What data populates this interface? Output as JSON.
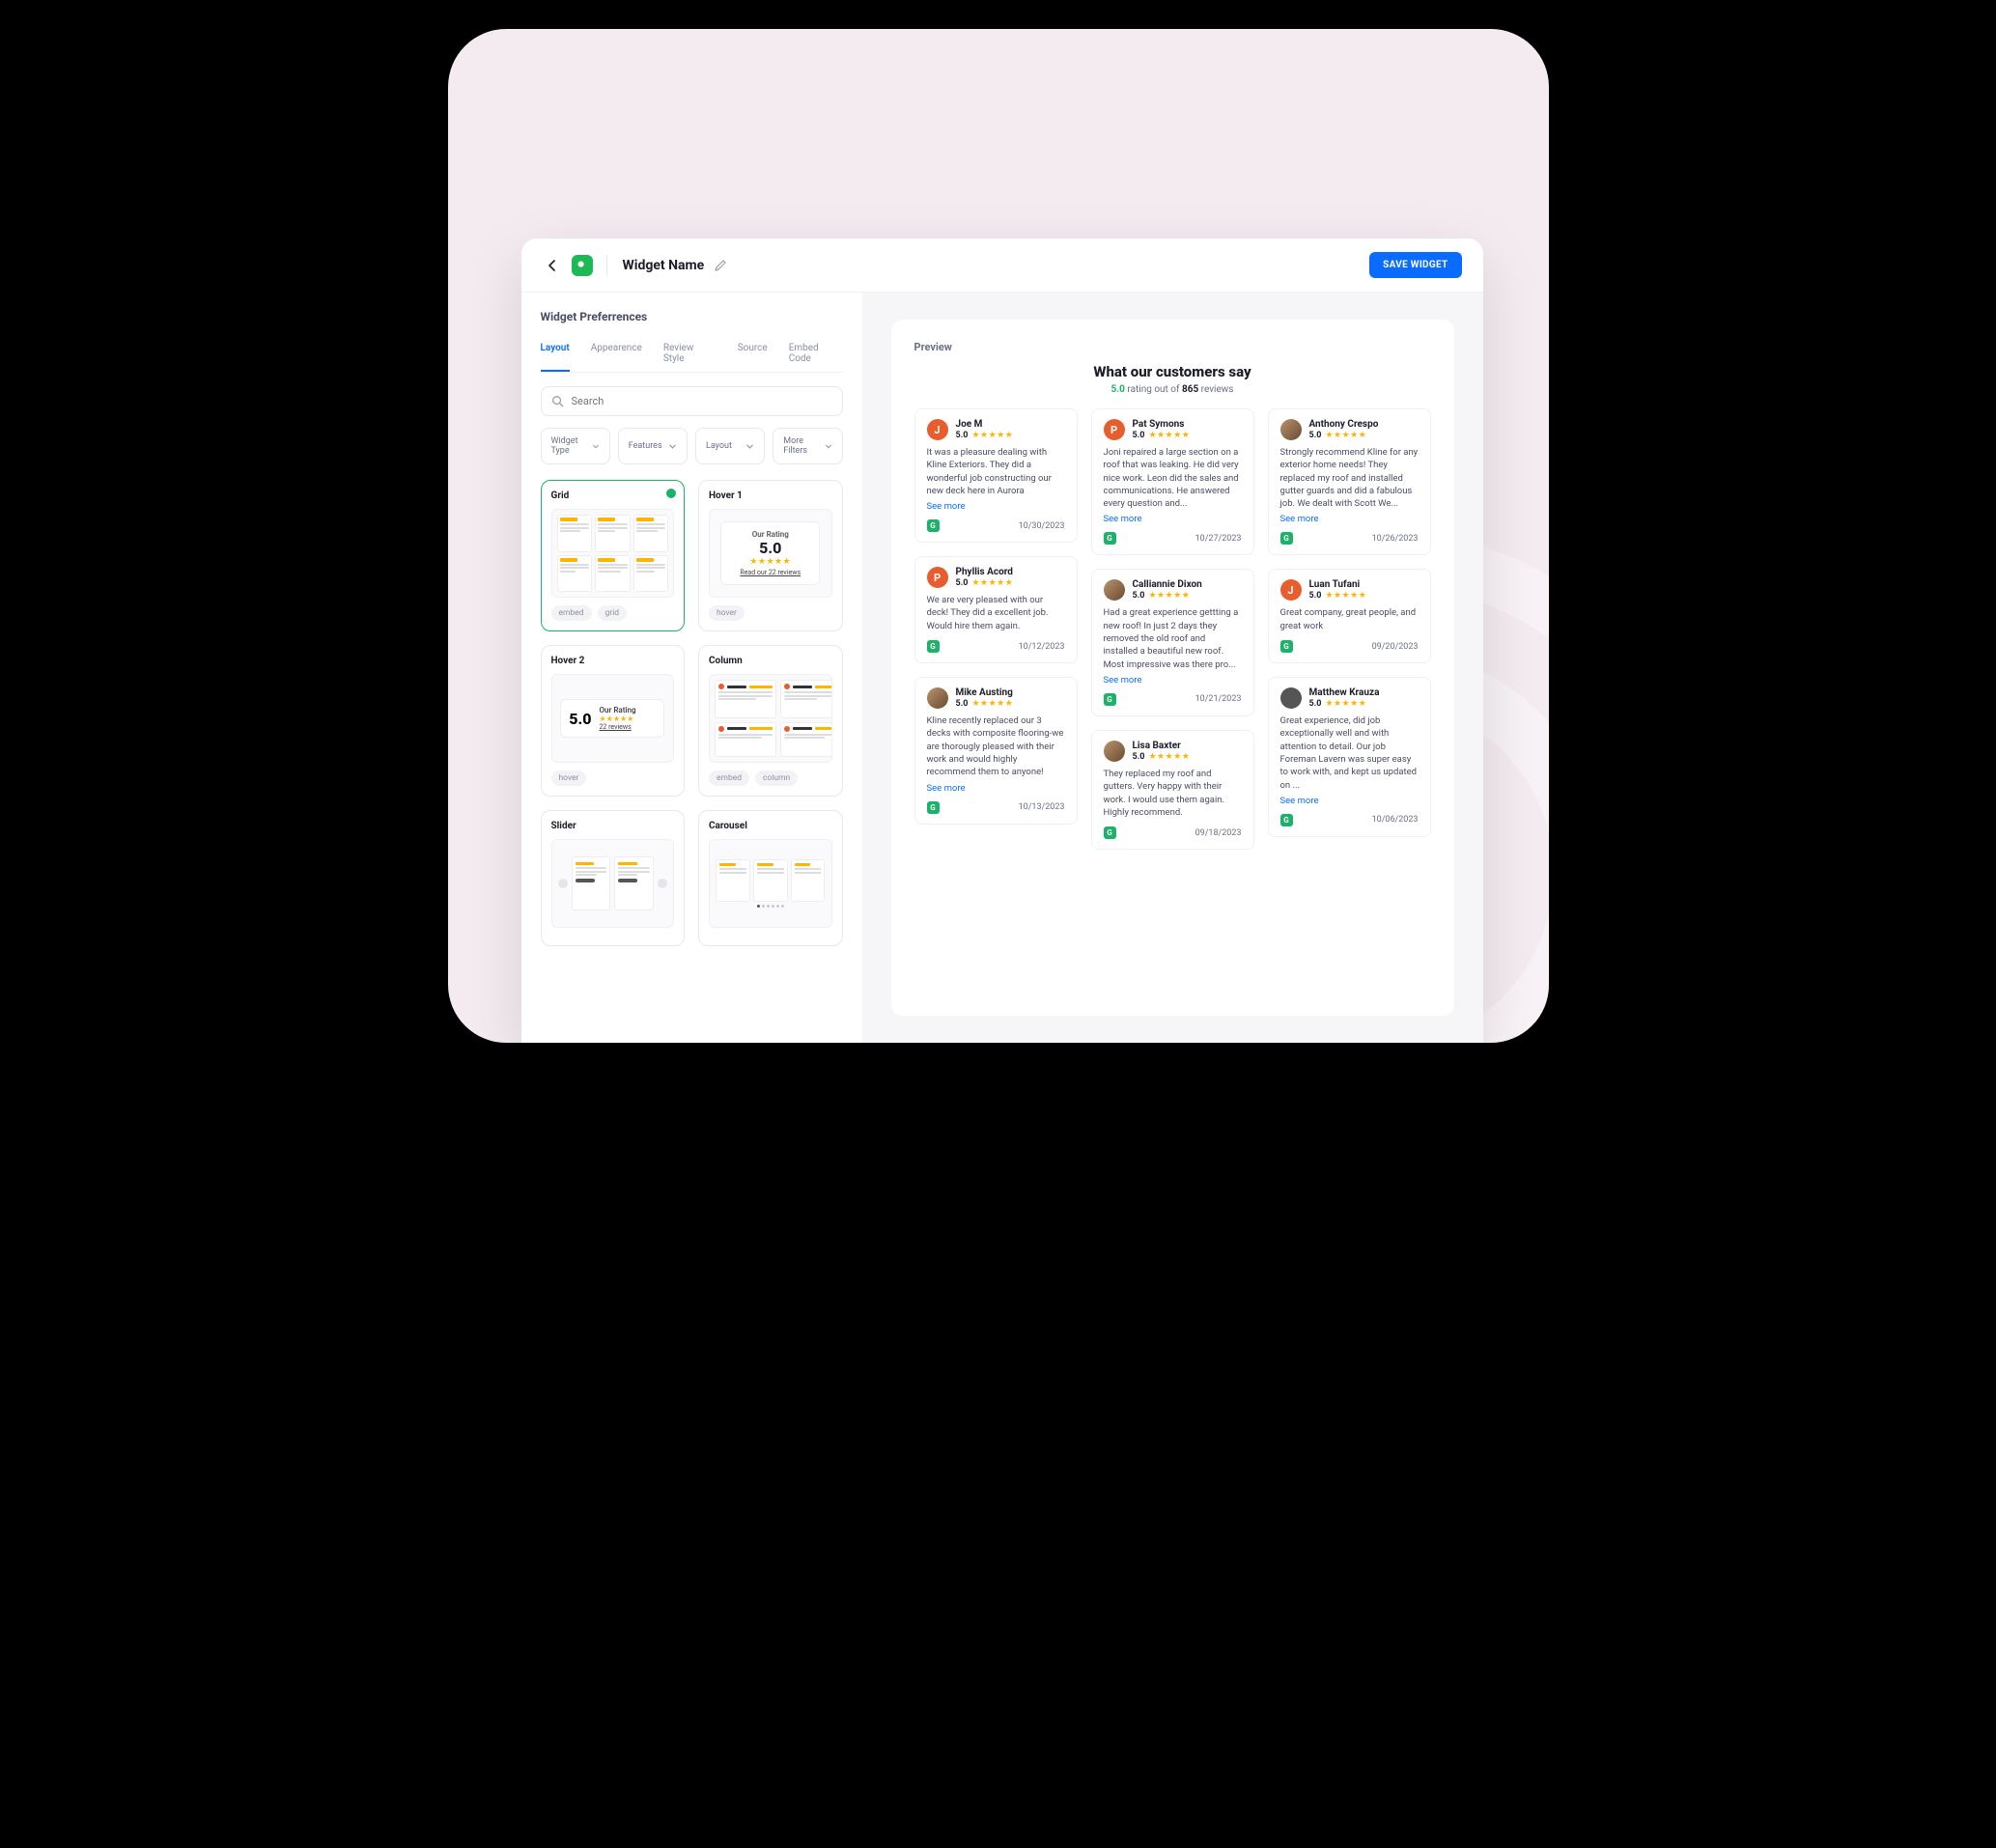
{
  "header": {
    "widget_name": "Widget Name",
    "save_label": "SAVE WIDGET"
  },
  "prefs": {
    "title": "Widget Preferrences",
    "tabs": [
      "Layout",
      "Appearence",
      "Review Style",
      "Source",
      "Embed Code"
    ],
    "search_placeholder": "Search",
    "filters": [
      "Widget Type",
      "Features",
      "Layout",
      "More Filters"
    ],
    "cards": [
      {
        "title": "Grid",
        "tags": [
          "embed",
          "grid"
        ],
        "selected": true,
        "thumb": "grid"
      },
      {
        "title": "Hover 1",
        "tags": [
          "hover"
        ],
        "thumb": "hover1",
        "rating_label": "Our Rating",
        "rating": "5.0",
        "link": "Read our 22 reviews"
      },
      {
        "title": "Hover 2",
        "tags": [
          "hover"
        ],
        "thumb": "hover2",
        "rating_label": "Our Rating",
        "rating": "5.0",
        "link": "22 reviews"
      },
      {
        "title": "Column",
        "tags": [
          "embed",
          "column"
        ],
        "thumb": "column"
      },
      {
        "title": "Slider",
        "tags": [],
        "thumb": "slider"
      },
      {
        "title": "Carousel",
        "tags": [],
        "thumb": "carousel"
      }
    ]
  },
  "preview": {
    "label": "Preview",
    "title": "What our customers say",
    "rating": "5.0",
    "rating_text_1": "rating out of",
    "count": "865",
    "rating_text_2": "reviews",
    "see_more": "See more",
    "columns": [
      [
        {
          "name": "Joe M",
          "initial": "J",
          "score": "5.0",
          "body": "It was a pleasure dealing with Kline Exteriors. They did a wonderful job constructing our new deck here in Aurora",
          "more": true,
          "date": "10/30/2023",
          "ava": "letter"
        },
        {
          "name": "Phyllis Acord",
          "initial": "P",
          "score": "5.0",
          "body": "We are very pleased with our deck! They did a excellent job. Would hire them again.",
          "more": false,
          "date": "10/12/2023",
          "ava": "letter"
        },
        {
          "name": "Mike Austing",
          "initial": "",
          "score": "5.0",
          "body": "Kline recently replaced our 3 decks with composite flooring-we are thorougly pleased with their work and would highly recommend them to anyone!",
          "more": true,
          "date": "10/13/2023",
          "ava": "img"
        }
      ],
      [
        {
          "name": "Pat Symons",
          "initial": "P",
          "score": "5.0",
          "body": "Joni repaired a large section on a roof that was leaking. He did very nice work. Leon did the sales and communications. He answered every question and...",
          "more": true,
          "date": "10/27/2023",
          "ava": "letter"
        },
        {
          "name": "Calliannie Dixon",
          "initial": "",
          "score": "5.0",
          "body": "Had a great experience gettting a new roof! In just 2 days they removed the old roof and installed a beautiful new roof. Most impressive was there pro...",
          "more": true,
          "date": "10/21/2023",
          "ava": "img"
        },
        {
          "name": "Lisa Baxter",
          "initial": "",
          "score": "5.0",
          "body": "They replaced my roof and gutters. Very happy with their work. I would use them again. Highly recommend.",
          "more": false,
          "date": "09/18/2023",
          "ava": "img"
        }
      ],
      [
        {
          "name": "Anthony Crespo",
          "initial": "",
          "score": "5.0",
          "body": "Strongly recommend Kline for any exterior home needs! They replaced my roof and installed gutter guards and did a fabulous job. We dealt with Scott We...",
          "more": true,
          "date": "10/26/2023",
          "ava": "img"
        },
        {
          "name": "Luan Tufani",
          "initial": "J",
          "score": "5.0",
          "body": "Great company, great people, and great work",
          "more": false,
          "date": "09/20/2023",
          "ava": "letter"
        },
        {
          "name": "Matthew Krauza",
          "initial": "",
          "score": "5.0",
          "body": "Great experience, did job exceptionally well and with attention to detail. Our job Foreman Lavern was super easy to work with, and kept us updated on ...",
          "more": true,
          "date": "10/06/2023",
          "ava": "gray"
        }
      ]
    ]
  }
}
